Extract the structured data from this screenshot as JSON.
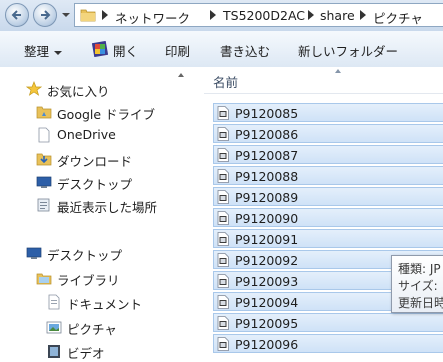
{
  "address_bar": {
    "crumbs": [
      "ネットワーク",
      "TS5200D2AC",
      "share",
      "ピクチャ"
    ]
  },
  "toolbar": {
    "organize": "整理",
    "open": "開く",
    "print": "印刷",
    "burn": "書き込む",
    "new_folder": "新しいフォルダー"
  },
  "nav": {
    "favorites": "お気に入り",
    "google_drive": "Google ドライブ",
    "onedrive": "OneDrive",
    "downloads": "ダウンロード",
    "desktop_fav": "デスクトップ",
    "recent": "最近表示した場所",
    "desktop": "デスクトップ",
    "libraries": "ライブラリ",
    "documents": "ドキュメント",
    "pictures": "ピクチャ",
    "videos": "ビデオ"
  },
  "list": {
    "column_name": "名前",
    "files": [
      "P9120085",
      "P9120086",
      "P9120087",
      "P9120088",
      "P9120089",
      "P9120090",
      "P9120091",
      "P9120092",
      "P9120093",
      "P9120094",
      "P9120095",
      "P9120096"
    ]
  },
  "tooltip": {
    "type": "種類: JP",
    "size": "サイズ:",
    "modified": "更新日時"
  }
}
